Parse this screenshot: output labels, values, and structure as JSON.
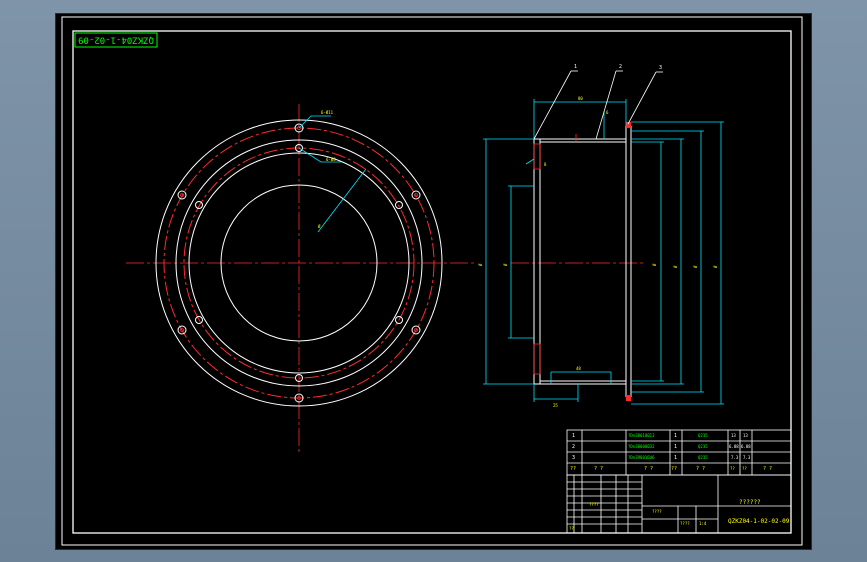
{
  "title_block_code": "QZKZ04-1-02-02-09",
  "drawing_code_rotated": "QZKZ04-1-02-09",
  "drawing_name": "??????",
  "balloons": [
    "1",
    "2",
    "3"
  ],
  "bom": [
    {
      "no": "1",
      "spec": "?Dn38018013",
      "qty": "1",
      "mat": "Q235",
      "w1": "13",
      "w2": "13"
    },
    {
      "no": "2",
      "spec": "?Dn38008032",
      "qty": "1",
      "mat": "Q235",
      "w1": "6.88",
      "w2": "6.88"
    },
    {
      "no": "3",
      "spec": "?Dn398016d6",
      "qty": "1",
      "mat": "Q235",
      "w1": "7.3",
      "w2": "7.3"
    }
  ],
  "bom_header": [
    "??",
    "? ?",
    "? ?",
    "??",
    "? ?",
    "??",
    "? ?",
    "? ?"
  ],
  "header_sub": [
    "??",
    "??"
  ],
  "cells": {
    "rev": "????",
    "stage": "????",
    "scale": "????",
    "sheet": "1:4",
    "unit": "??"
  },
  "colors": {
    "sheet": "#000000",
    "white": "#ffffff",
    "red": "#ff2a2a",
    "cyan": "#00e5ff",
    "yellow": "#ffff00",
    "green": "#00ff00",
    "frame": "#ffffff",
    "background": "#738aa0"
  },
  "icons": [
    "drawing-frame",
    "title-block",
    "circle-view",
    "section-view"
  ]
}
